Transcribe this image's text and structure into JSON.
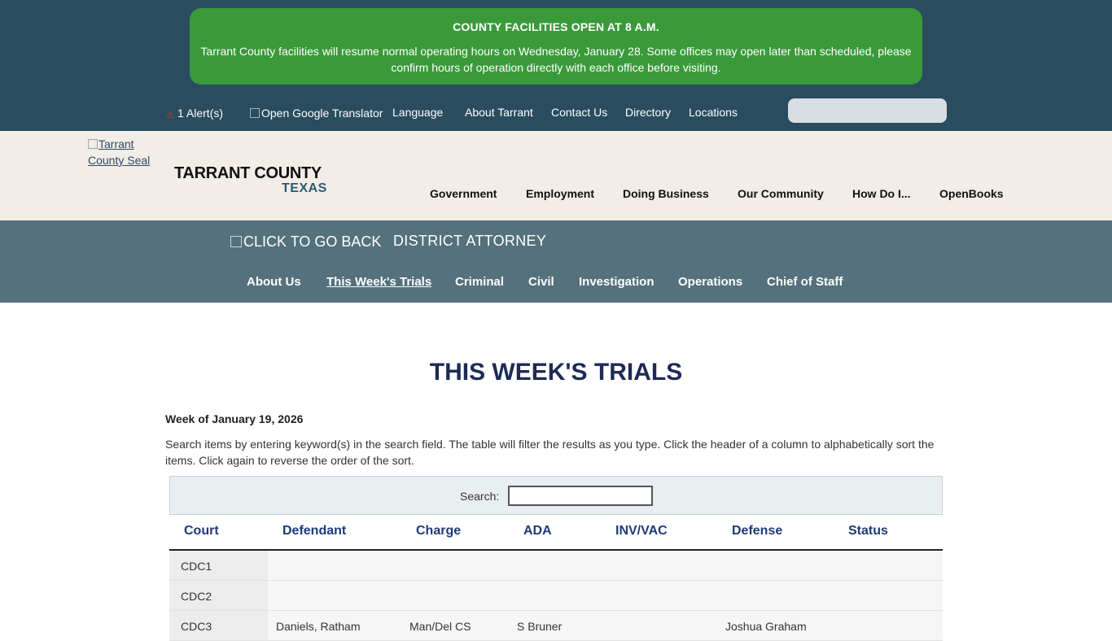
{
  "alert": {
    "title": "COUNTY FACILITIES OPEN AT 8 A.M.",
    "body": "Tarrant County facilities will resume normal operating hours on Wednesday, January 28. Some offices may open later than scheduled, please confirm hours of operation directly with each office before visiting."
  },
  "utility_bar": {
    "alert_count": "1 Alert(s)",
    "translator_alt": "Open Google Translator",
    "language": "Language",
    "links": [
      "About Tarrant",
      "Contact Us",
      "Directory",
      "Locations"
    ],
    "search_placeholder": ""
  },
  "county_header": {
    "seal_alt": "Tarrant County Seal",
    "name": "TARRANT COUNTY",
    "state": "TEXAS",
    "nav": [
      "Government",
      "Employment",
      "Doing Business",
      "Our Community",
      "How Do I...",
      "OpenBooks"
    ]
  },
  "department": {
    "back_alt": "Click to go back",
    "title": "DISTRICT ATTORNEY",
    "nav": [
      "About Us",
      "This Week's Trials",
      "Criminal",
      "Civil",
      "Investigation",
      "Operations",
      "Chief of Staff"
    ],
    "active": "This Week's Trials"
  },
  "main": {
    "title": "THIS WEEK'S TRIALS",
    "week_of": "Week of January 19, 2026",
    "instructions": "Search items by entering keyword(s) in the search field. The table will filter the results as you type. Click the header of a column to alphabetically sort the items. Click again to reverse the order of the sort.",
    "search_label": "Search:",
    "search_value": ""
  },
  "table": {
    "headers": [
      "Court",
      "Defendant",
      "Charge",
      "ADA",
      "INV/VAC",
      "Defense",
      "Status"
    ],
    "rows": [
      [
        "CDC1",
        "",
        "",
        "",
        "",
        "",
        ""
      ],
      [
        "CDC2",
        "",
        "",
        "",
        "",
        "",
        ""
      ],
      [
        "CDC3",
        "Daniels, Ratham",
        "Man/Del CS",
        "S Bruner",
        "",
        "Joshua Graham",
        ""
      ]
    ]
  },
  "colors": {
    "top_band": "#294c5e",
    "alert_green": "#3a9a3a",
    "header_cream": "#f2ede6",
    "dept_band": "#54717d",
    "title_navy": "#1d2a55",
    "table_header_blue": "#1d3a7a"
  }
}
